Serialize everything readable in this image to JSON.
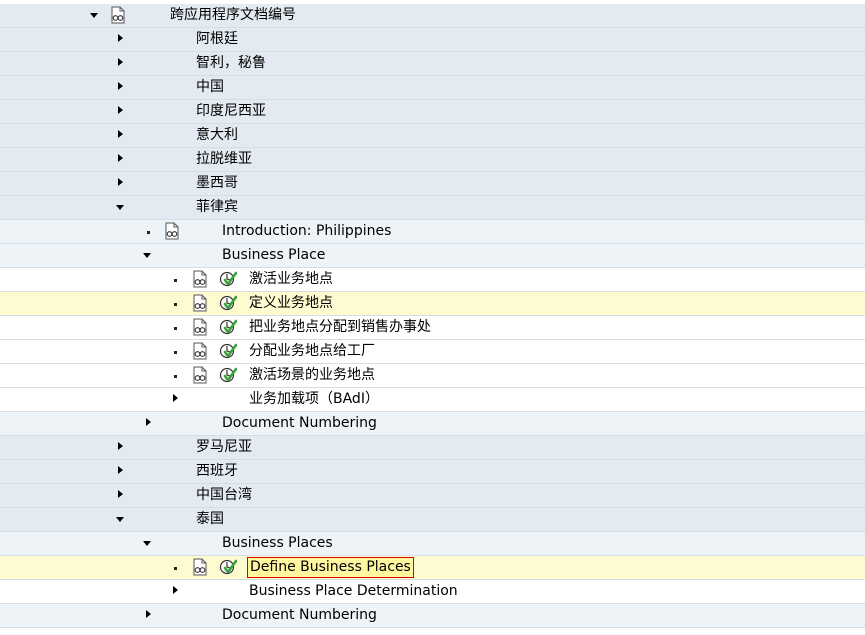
{
  "tree": {
    "root": {
      "label": "跨应用程序文档编号"
    },
    "countries": [
      {
        "label": "阿根廷"
      },
      {
        "label": "智利，秘鲁"
      },
      {
        "label": "中国"
      },
      {
        "label": "印度尼西亚"
      },
      {
        "label": "意大利"
      },
      {
        "label": "拉脱维亚"
      },
      {
        "label": "墨西哥"
      },
      {
        "label": "菲律宾"
      }
    ],
    "philippines": {
      "intro": "Introduction: Philippines",
      "business_place": {
        "label": "Business Place",
        "activities": [
          {
            "label": "激活业务地点"
          },
          {
            "label": "定义业务地点"
          },
          {
            "label": "把业务地点分配到销售办事处"
          },
          {
            "label": "分配业务地点给工厂"
          },
          {
            "label": "激活场景的业务地点"
          }
        ],
        "badi": "业务加载项（BAdI）"
      },
      "doc_numbering": "Document Numbering"
    },
    "more_countries": [
      {
        "label": "罗马尼亚"
      },
      {
        "label": "西班牙"
      },
      {
        "label": "中国台湾"
      },
      {
        "label": "泰国"
      }
    ],
    "thailand": {
      "business_places": {
        "label": "Business Places",
        "define": "Define Business Places",
        "determination": "Business Place Determination"
      },
      "doc_numbering": "Document Numbering"
    }
  },
  "colors": {
    "level_top": "#e3eaf2",
    "level_mid": "#eef3f8",
    "highlight": "#fffbd0",
    "selection_border": "#e00000",
    "activity_green": "#3aa13a"
  },
  "icons": {
    "document": "glasses-document-icon",
    "execute": "execute-clock-check-icon"
  }
}
